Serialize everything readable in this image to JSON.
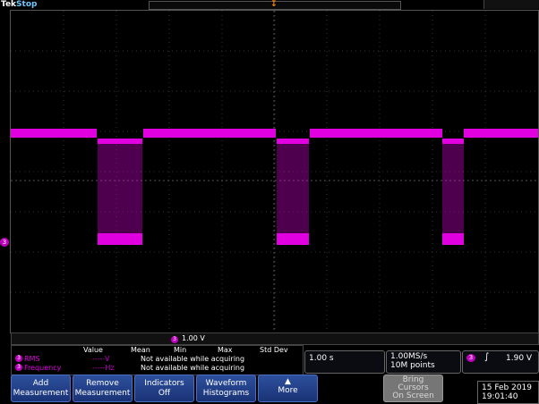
{
  "header": {
    "brand": "Tek",
    "status": "Stop"
  },
  "waveform": {
    "channel_marker": "3",
    "color": "#e000e0"
  },
  "scale": {
    "channel": "3",
    "vertical": "1.00 V"
  },
  "measurements": {
    "columns": [
      "Value",
      "Mean",
      "Min",
      "Max",
      "Std Dev"
    ],
    "rows": [
      {
        "channel": "3",
        "label": "RMS",
        "value": "-----V",
        "message": "Not available while acquiring"
      },
      {
        "channel": "3",
        "label": "Frequency",
        "value": "-----Hz",
        "message": "Not available while acquiring"
      }
    ]
  },
  "horizontal": {
    "time_per_div": "1.00 s"
  },
  "acquisition": {
    "sample_rate": "1.00MS/s",
    "record_length": "10M points"
  },
  "trigger": {
    "channel": "3",
    "slope_icon": "rising-edge-icon",
    "level": "1.90 V"
  },
  "buttons": {
    "add_measurement": [
      "Add",
      "Measurement"
    ],
    "remove_measurement": [
      "Remove",
      "Measurement"
    ],
    "indicators": [
      "Indicators",
      "Off"
    ],
    "waveform_histograms": [
      "Waveform",
      "Histograms"
    ],
    "more": "More",
    "bring_cursors": [
      "Bring",
      "Cursors",
      "On Screen"
    ]
  },
  "clock": {
    "date": "15 Feb 2019",
    "time": "19:01:40"
  }
}
